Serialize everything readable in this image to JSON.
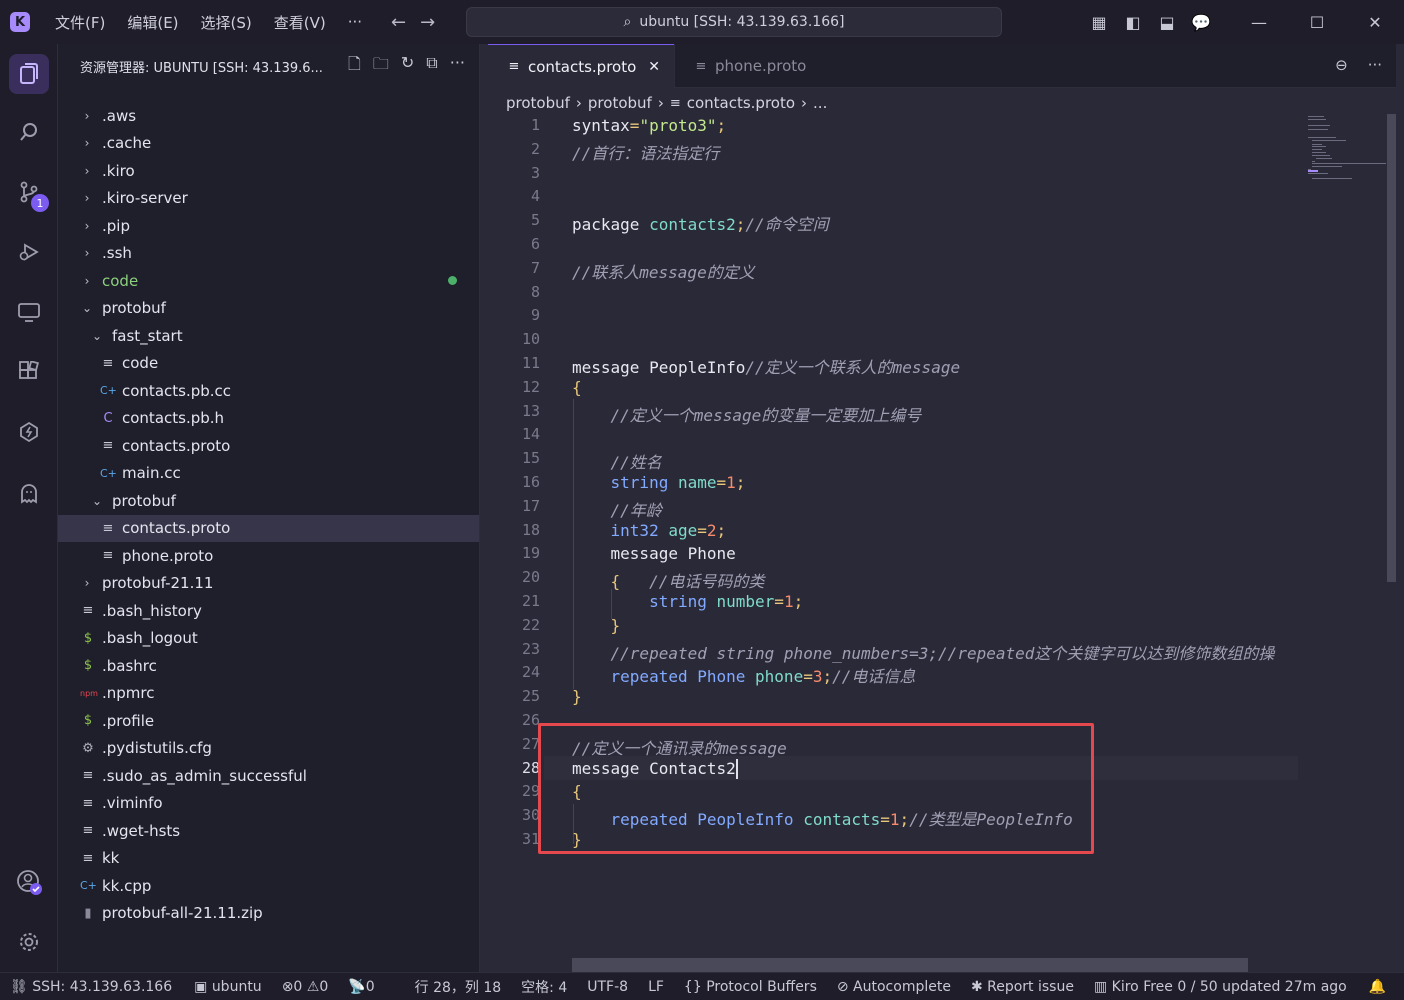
{
  "titlebar": {
    "menus": [
      "文件(F)",
      "编辑(E)",
      "选择(S)",
      "查看(V)",
      "···"
    ],
    "search": "ubuntu [SSH: 43.139.63.166]"
  },
  "activity": {
    "scm_badge": "1"
  },
  "explorer": {
    "title": "资源管理器: UBUNTU [SSH: 43.139.6...",
    "items": [
      {
        "label": ".aws",
        "icon": "folder",
        "depth": 0
      },
      {
        "label": ".cache",
        "icon": "folder",
        "depth": 0
      },
      {
        "label": ".kiro",
        "icon": "folder",
        "depth": 0
      },
      {
        "label": ".kiro-server",
        "icon": "folder",
        "depth": 0
      },
      {
        "label": ".pip",
        "icon": "folder",
        "depth": 0
      },
      {
        "label": ".ssh",
        "icon": "folder",
        "depth": 0
      },
      {
        "label": "code",
        "icon": "folder",
        "depth": 0
      },
      {
        "label": "protobuf",
        "icon": "folder-open",
        "depth": 0
      },
      {
        "label": "fast_start",
        "icon": "folder-open",
        "depth": 1
      },
      {
        "label": "code",
        "icon": "file-lines",
        "depth": 2
      },
      {
        "label": "contacts.pb.cc",
        "icon": "cpp",
        "depth": 2
      },
      {
        "label": "contacts.pb.h",
        "icon": "c-header",
        "depth": 2
      },
      {
        "label": "contacts.proto",
        "icon": "file-lines",
        "depth": 2
      },
      {
        "label": "main.cc",
        "icon": "cpp",
        "depth": 2
      },
      {
        "label": "protobuf",
        "icon": "folder-open",
        "depth": 1
      },
      {
        "label": "contacts.proto",
        "icon": "file-lines",
        "depth": 2
      },
      {
        "label": "phone.proto",
        "icon": "file-lines",
        "depth": 2
      },
      {
        "label": "protobuf-21.11",
        "icon": "folder",
        "depth": 0
      },
      {
        "label": ".bash_history",
        "icon": "file-lines",
        "depth": 0
      },
      {
        "label": ".bash_logout",
        "icon": "shell",
        "depth": 0
      },
      {
        "label": ".bashrc",
        "icon": "shell",
        "depth": 0
      },
      {
        "label": ".npmrc",
        "icon": "npm",
        "depth": 0
      },
      {
        "label": ".profile",
        "icon": "shell",
        "depth": 0
      },
      {
        "label": ".pydistutils.cfg",
        "icon": "gear",
        "depth": 0
      },
      {
        "label": ".sudo_as_admin_successful",
        "icon": "file-lines",
        "depth": 0
      },
      {
        "label": ".viminfo",
        "icon": "file-lines",
        "depth": 0
      },
      {
        "label": ".wget-hsts",
        "icon": "file-lines",
        "depth": 0
      },
      {
        "label": "kk",
        "icon": "file-lines",
        "depth": 0
      },
      {
        "label": "kk.cpp",
        "icon": "cpp",
        "depth": 0
      },
      {
        "label": "protobuf-all-21.11.zip",
        "icon": "zip",
        "depth": 0
      }
    ]
  },
  "tabs": [
    {
      "label": "contacts.proto",
      "close": "✕"
    },
    {
      "label": "phone.proto"
    }
  ],
  "breadcrumb": [
    "protobuf",
    "protobuf",
    "contacts.proto",
    "..."
  ],
  "code_lines": [
    [
      [
        "kw",
        "syntax"
      ],
      [
        "pn",
        "="
      ],
      [
        "st",
        "\"proto3\""
      ],
      [
        "pn",
        ";"
      ]
    ],
    [
      [
        "cm",
        "//首行：语法指定行"
      ]
    ],
    [],
    [],
    [
      [
        "kw",
        "package "
      ],
      [
        "id",
        "contacts2"
      ],
      [
        "pn",
        ";"
      ],
      [
        "cm",
        "//命令空间"
      ]
    ],
    [],
    [
      [
        "cm",
        "//联系人message的定义"
      ]
    ],
    [],
    [],
    [],
    [
      [
        "kw",
        "message "
      ],
      [
        "kw",
        "PeopleInfo"
      ],
      [
        "cm",
        "//定义一个联系人的message"
      ]
    ],
    [
      [
        "pn",
        "{"
      ]
    ],
    [
      [
        "kw",
        "    "
      ],
      [
        "cm",
        "//定义一个message的变量一定要加上编号"
      ]
    ],
    [],
    [
      [
        "kw",
        "    "
      ],
      [
        "cm",
        "//姓名"
      ]
    ],
    [
      [
        "kw",
        "    "
      ],
      [
        "ty",
        "string "
      ],
      [
        "id",
        "name"
      ],
      [
        "pn",
        "="
      ],
      [
        "nm",
        "1"
      ],
      [
        "pn",
        ";"
      ]
    ],
    [
      [
        "kw",
        "    "
      ],
      [
        "cm",
        "//年龄"
      ]
    ],
    [
      [
        "kw",
        "    "
      ],
      [
        "ty",
        "int32 "
      ],
      [
        "id",
        "age"
      ],
      [
        "pn",
        "="
      ],
      [
        "nm",
        "2"
      ],
      [
        "pn",
        ";"
      ]
    ],
    [
      [
        "kw",
        "    message "
      ],
      [
        "kw",
        "Phone"
      ]
    ],
    [
      [
        "kw",
        "    "
      ],
      [
        "pn",
        "{"
      ],
      [
        "kw",
        "   "
      ],
      [
        "cm",
        "//电话号码的类"
      ]
    ],
    [
      [
        "kw",
        "        "
      ],
      [
        "ty",
        "string "
      ],
      [
        "id",
        "number"
      ],
      [
        "pn",
        "="
      ],
      [
        "nm",
        "1"
      ],
      [
        "pn",
        ";"
      ]
    ],
    [
      [
        "kw",
        "    "
      ],
      [
        "pn",
        "}"
      ]
    ],
    [
      [
        "kw",
        "    "
      ],
      [
        "cm",
        "//repeated string phone_numbers=3;//repeated这个关键字可以达到修饰数组的操"
      ]
    ],
    [
      [
        "kw",
        "    "
      ],
      [
        "ty",
        "repeated "
      ],
      [
        "ty",
        "Phone "
      ],
      [
        "id",
        "phone"
      ],
      [
        "pn",
        "="
      ],
      [
        "nm",
        "3"
      ],
      [
        "pn",
        ";"
      ],
      [
        "cm",
        "//电话信息"
      ]
    ],
    [
      [
        "pn",
        "}"
      ]
    ],
    [],
    [
      [
        "cm",
        "//定义一个通讯录的message"
      ]
    ],
    [
      [
        "kw",
        "message "
      ],
      [
        "kw",
        "Contacts2"
      ]
    ],
    [
      [
        "pn",
        "{"
      ]
    ],
    [
      [
        "kw",
        "    "
      ],
      [
        "ty",
        "repeated "
      ],
      [
        "ty",
        "PeopleInfo "
      ],
      [
        "id",
        "contacts"
      ],
      [
        "pn",
        "="
      ],
      [
        "nm",
        "1"
      ],
      [
        "pn",
        ";"
      ],
      [
        "cm",
        "//类型是PeopleInfo"
      ]
    ],
    [
      [
        "pn",
        "}"
      ]
    ]
  ],
  "status": {
    "remote": "SSH: 43.139.63.166",
    "host": "ubuntu",
    "errors": "0",
    "warnings": "0",
    "ports": "0",
    "position": "行 28，列 18",
    "indent": "空格: 4",
    "encoding": "UTF-8",
    "eol": "LF",
    "language": "Protocol Buffers",
    "autocomplete": "Autocomplete",
    "report": "Report issue",
    "kiro": "Kiro Free 0 / 50 updated 27m ago"
  }
}
